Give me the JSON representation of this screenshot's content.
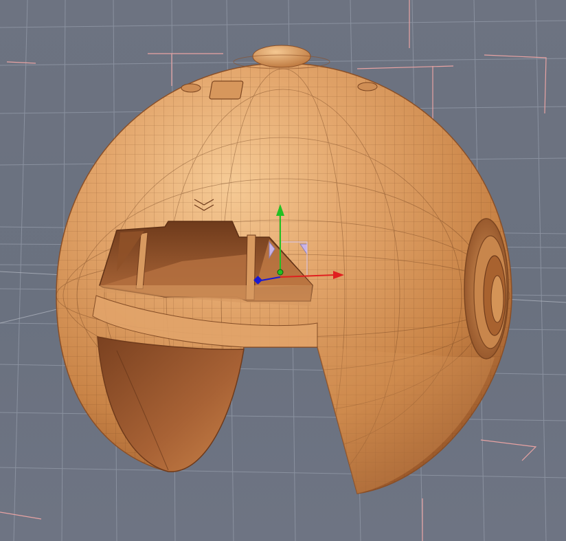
{
  "viewport": {
    "background_color": "#6b7280",
    "grid_color": "#8e95a3",
    "selection_bracket_color": "#e9a3a3"
  },
  "model": {
    "base_color": "#d8975f",
    "highlight_color": "#f3c48f",
    "shadow_color": "#8a4f27",
    "wire_color": "#6e3f1d",
    "interior_color": "#a96335"
  },
  "gizmo": {
    "x_axis_color": "#e02020",
    "y_axis_color": "#22c022",
    "z_axis_color": "#1a1ad0",
    "plane_color": "#c9b3e6"
  }
}
